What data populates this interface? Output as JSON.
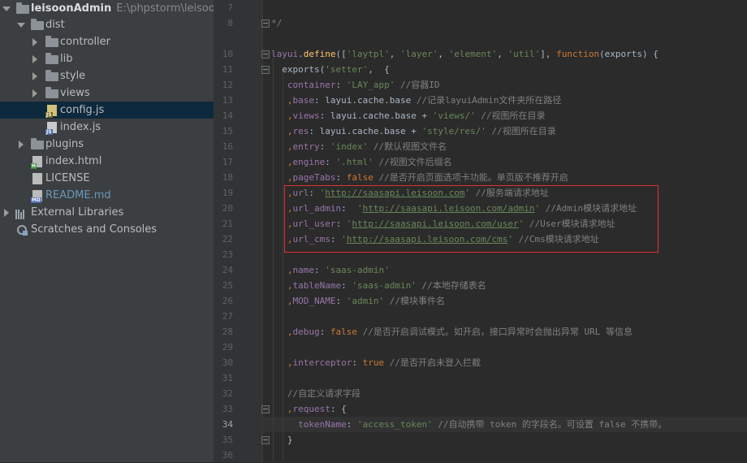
{
  "project_tree": {
    "items": [
      {
        "label": "leisoonAdmin",
        "path": "E:\\phpstorm\\leisoonAd"
      },
      {
        "label": "dist"
      },
      {
        "label": "controller"
      },
      {
        "label": "lib"
      },
      {
        "label": "style"
      },
      {
        "label": "views"
      },
      {
        "label": "config.js",
        "badge": "JS"
      },
      {
        "label": "index.js",
        "badge": "JS"
      },
      {
        "label": "plugins"
      },
      {
        "label": "index.html",
        "badge": "H"
      },
      {
        "label": "LICENSE"
      },
      {
        "label": "README.md",
        "badge": "MD"
      },
      {
        "label": "External Libraries"
      },
      {
        "label": "Scratches and Consoles"
      }
    ]
  },
  "editor": {
    "line_numbers": [
      "7",
      "8",
      "10",
      "11",
      "12",
      "13",
      "14",
      "15",
      "16",
      "17",
      "18",
      "19",
      "20",
      "21",
      "22",
      "23",
      "24",
      "25",
      "26",
      "27",
      "28",
      "29",
      "30",
      "31",
      "32",
      "33",
      "34",
      "35",
      "36"
    ],
    "active_line": "34",
    "lines": [
      {
        "tokens": [
          {
            "t": "",
            "c": "c"
          }
        ]
      },
      {
        "tokens": [
          {
            "t": "*/",
            "c": "c"
          }
        ]
      },
      {
        "tokens": [
          {
            "t": "layui",
            "c": "pr"
          },
          {
            "t": ".",
            "c": "p"
          },
          {
            "t": "define",
            "c": "f"
          },
          {
            "t": "([",
            "c": "p"
          },
          {
            "t": "'laytpl'",
            "c": "s"
          },
          {
            "t": ", ",
            "c": "p"
          },
          {
            "t": "'layer'",
            "c": "s"
          },
          {
            "t": ", ",
            "c": "p"
          },
          {
            "t": "'element'",
            "c": "s"
          },
          {
            "t": ", ",
            "c": "p"
          },
          {
            "t": "'util'",
            "c": "s"
          },
          {
            "t": "], ",
            "c": "p"
          },
          {
            "t": "function",
            "c": "k"
          },
          {
            "t": "(exports) {",
            "c": "p"
          }
        ]
      },
      {
        "tokens": [
          {
            "t": "  exports(",
            "c": "p"
          },
          {
            "t": "'setter'",
            "c": "s"
          },
          {
            "t": ",  {",
            "c": "p"
          }
        ]
      },
      {
        "tokens": [
          {
            "t": "   container",
            "c": "pr"
          },
          {
            "t": ": ",
            "c": "p"
          },
          {
            "t": "'LAY_app'",
            "c": "s"
          },
          {
            "t": " //容器ID",
            "c": "c"
          }
        ]
      },
      {
        "tokens": [
          {
            "t": "   ,",
            "c": "k"
          },
          {
            "t": "base",
            "c": "pr"
          },
          {
            "t": ": layui.cache.base ",
            "c": "p"
          },
          {
            "t": "//记录layuiAdmin文件夹所在路径",
            "c": "c"
          }
        ]
      },
      {
        "tokens": [
          {
            "t": "   ,",
            "c": "k"
          },
          {
            "t": "views",
            "c": "pr"
          },
          {
            "t": ": layui.cache.base + ",
            "c": "p"
          },
          {
            "t": "'views/'",
            "c": "s"
          },
          {
            "t": " //视图所在目录",
            "c": "c"
          }
        ]
      },
      {
        "tokens": [
          {
            "t": "   ,",
            "c": "k"
          },
          {
            "t": "res",
            "c": "pr"
          },
          {
            "t": ": layui.cache.base + ",
            "c": "p"
          },
          {
            "t": "'style/res/'",
            "c": "s"
          },
          {
            "t": " //视图所在目录",
            "c": "c"
          }
        ]
      },
      {
        "tokens": [
          {
            "t": "   ,",
            "c": "k"
          },
          {
            "t": "entry",
            "c": "pr"
          },
          {
            "t": ": ",
            "c": "p"
          },
          {
            "t": "'index'",
            "c": "s"
          },
          {
            "t": " //默认视图文件名",
            "c": "c"
          }
        ]
      },
      {
        "tokens": [
          {
            "t": "   ,",
            "c": "k"
          },
          {
            "t": "engine",
            "c": "pr"
          },
          {
            "t": ": ",
            "c": "p"
          },
          {
            "t": "'.html'",
            "c": "s"
          },
          {
            "t": " //视图文件后缀名",
            "c": "c"
          }
        ]
      },
      {
        "tokens": [
          {
            "t": "   ,",
            "c": "k"
          },
          {
            "t": "pageTabs",
            "c": "pr"
          },
          {
            "t": ": ",
            "c": "p"
          },
          {
            "t": "false",
            "c": "k"
          },
          {
            "t": " //是否开启页面选项卡功能。单页版不推荐开启",
            "c": "c"
          }
        ]
      },
      {
        "tokens": [
          {
            "t": "   ,",
            "c": "k"
          },
          {
            "t": "url",
            "c": "pr"
          },
          {
            "t": ": ",
            "c": "p"
          },
          {
            "t": "'",
            "c": "s"
          },
          {
            "t": "http://saasapi.leisoon.com",
            "c": "su"
          },
          {
            "t": "'",
            "c": "s"
          },
          {
            "t": " //服务端请求地址",
            "c": "c"
          }
        ]
      },
      {
        "tokens": [
          {
            "t": "   ,",
            "c": "k"
          },
          {
            "t": "url_admin",
            "c": "pr"
          },
          {
            "t": ":  ",
            "c": "p"
          },
          {
            "t": "'",
            "c": "s"
          },
          {
            "t": "http://saasapi.leisoon.com/admin",
            "c": "su"
          },
          {
            "t": "'",
            "c": "s"
          },
          {
            "t": " //Admin模块请求地址",
            "c": "c"
          }
        ]
      },
      {
        "tokens": [
          {
            "t": "   ,",
            "c": "k"
          },
          {
            "t": "url_user",
            "c": "pr"
          },
          {
            "t": ": ",
            "c": "p"
          },
          {
            "t": "'",
            "c": "s"
          },
          {
            "t": "http://saasapi.leisoon.com/user",
            "c": "su"
          },
          {
            "t": "'",
            "c": "s"
          },
          {
            "t": " //User模块请求地址",
            "c": "c"
          }
        ]
      },
      {
        "tokens": [
          {
            "t": "   ,",
            "c": "k"
          },
          {
            "t": "url_cms",
            "c": "pr"
          },
          {
            "t": ": ",
            "c": "p"
          },
          {
            "t": "'",
            "c": "s"
          },
          {
            "t": "http://saasapi.leisoon.com/cms",
            "c": "su"
          },
          {
            "t": "'",
            "c": "s"
          },
          {
            "t": " //Cms模块请求地址",
            "c": "c"
          }
        ]
      },
      {
        "tokens": []
      },
      {
        "tokens": [
          {
            "t": "   ,",
            "c": "k"
          },
          {
            "t": "name",
            "c": "pr"
          },
          {
            "t": ": ",
            "c": "p"
          },
          {
            "t": "'saas-admin'",
            "c": "s"
          }
        ]
      },
      {
        "tokens": [
          {
            "t": "   ,",
            "c": "k"
          },
          {
            "t": "tableName",
            "c": "pr"
          },
          {
            "t": ": ",
            "c": "p"
          },
          {
            "t": "'saas-admin'",
            "c": "s"
          },
          {
            "t": " //本地存储表名",
            "c": "c"
          }
        ]
      },
      {
        "tokens": [
          {
            "t": "   ,",
            "c": "k"
          },
          {
            "t": "MOD_NAME",
            "c": "pr"
          },
          {
            "t": ": ",
            "c": "p"
          },
          {
            "t": "'admin'",
            "c": "s"
          },
          {
            "t": " //模块事件名",
            "c": "c"
          }
        ]
      },
      {
        "tokens": []
      },
      {
        "tokens": [
          {
            "t": "   ,",
            "c": "k"
          },
          {
            "t": "debug",
            "c": "pr"
          },
          {
            "t": ": ",
            "c": "p"
          },
          {
            "t": "false",
            "c": "k"
          },
          {
            "t": " //是否开启调试模式。如开启，接口异常时会抛出异常 URL 等信息",
            "c": "c"
          }
        ]
      },
      {
        "tokens": []
      },
      {
        "tokens": [
          {
            "t": "   ,",
            "c": "k"
          },
          {
            "t": "interceptor",
            "c": "pr"
          },
          {
            "t": ": ",
            "c": "p"
          },
          {
            "t": "true",
            "c": "k"
          },
          {
            "t": " //是否开启未登入拦截",
            "c": "c"
          }
        ]
      },
      {
        "tokens": []
      },
      {
        "tokens": [
          {
            "t": "   //自定义请求字段",
            "c": "c"
          }
        ]
      },
      {
        "tokens": [
          {
            "t": "   ,",
            "c": "k"
          },
          {
            "t": "request",
            "c": "pr"
          },
          {
            "t": ": {",
            "c": "p"
          }
        ]
      },
      {
        "tokens": [
          {
            "t": "     tokenName",
            "c": "pr"
          },
          {
            "t": ": ",
            "c": "p"
          },
          {
            "t": "'access_token'",
            "c": "s"
          },
          {
            "t": " //自动携带 token 的字段名。可设置 false 不携带。",
            "c": "c"
          }
        ]
      },
      {
        "tokens": [
          {
            "t": "   }",
            "c": "p"
          }
        ]
      },
      {
        "tokens": []
      }
    ]
  },
  "colors": {
    "sidebar_bg": "#3c3f41",
    "editor_bg": "#2b2b2b",
    "keyword": "#cc7832",
    "string": "#6a8759",
    "comment": "#808080",
    "property": "#9876aa",
    "highlight_box": "#e03030"
  },
  "icons": [
    "folder-icon",
    "library-icon",
    "scratches-icon",
    "js-file-icon",
    "html-file-icon",
    "text-file-icon",
    "markdown-file-icon"
  ]
}
